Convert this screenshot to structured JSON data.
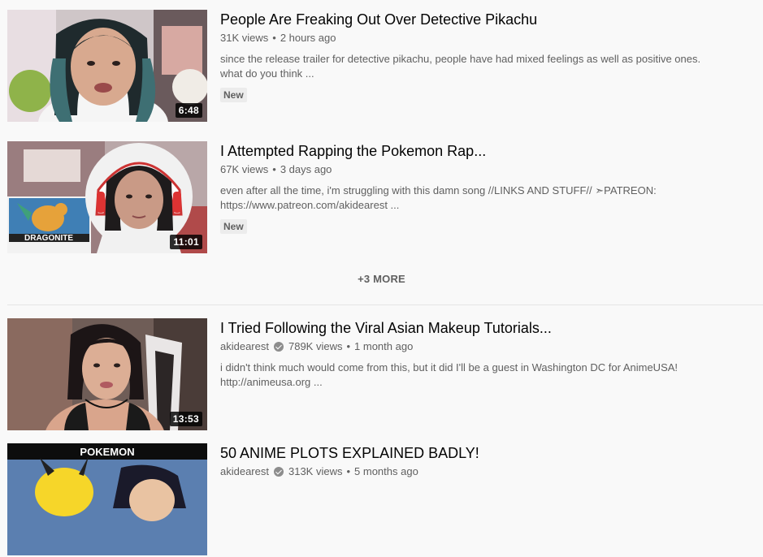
{
  "videos": [
    {
      "title": "People Are Freaking Out Over Detective Pikachu",
      "channel": "",
      "views": "31K views",
      "age": "2 hours ago",
      "description": "since the release trailer for detective pikachu, people have had mixed feelings as well as positive ones. what do you think ...",
      "badge": "New",
      "duration": "6:48"
    },
    {
      "title": "I Attempted Rapping the Pokemon Rap...",
      "channel": "",
      "views": "67K views",
      "age": "3 days ago",
      "description": "even after all the time, i'm struggling with this damn song //LINKS AND STUFF// ➣PATREON: https://www.patreon.com/akidearest ...",
      "badge": "New",
      "duration": "11:01",
      "thumb_text": "DRAGONITE"
    },
    {
      "title": "I Tried Following the Viral Asian Makeup Tutorials...",
      "channel": "akidearest",
      "views": "789K views",
      "age": "1 month ago",
      "description": "i didn't think much would come from this, but it did I'll be a guest in Washington DC for AnimeUSA! http://animeusa.org ...",
      "badge": "",
      "duration": "13:53"
    },
    {
      "title": "50 ANIME PLOTS EXPLAINED BADLY!",
      "channel": "akidearest",
      "views": "313K views",
      "age": "5 months ago",
      "description": "",
      "badge": "",
      "duration": "",
      "thumb_text": "POKEMON"
    }
  ],
  "more_label": "+3 MORE",
  "colors": {
    "background": "#f9f9f9",
    "title": "#030303",
    "meta": "#606060",
    "badge_bg": "#ececec"
  }
}
